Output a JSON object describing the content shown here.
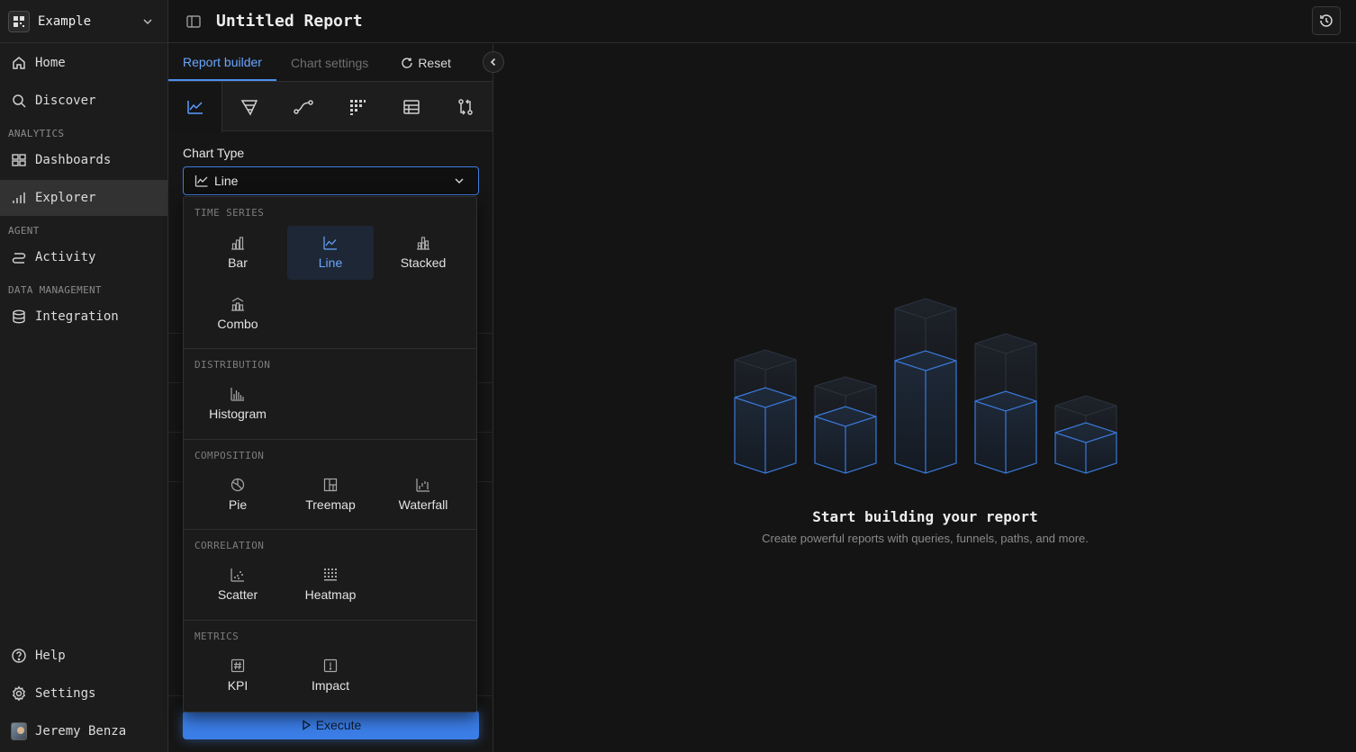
{
  "workspace": {
    "name": "Example"
  },
  "sidebar": {
    "home": "Home",
    "discover": "Discover",
    "section_analytics": "ANALYTICS",
    "dashboards": "Dashboards",
    "explorer": "Explorer",
    "section_agent": "AGENT",
    "activity": "Activity",
    "section_data": "DATA MANAGEMENT",
    "integration": "Integration",
    "help": "Help",
    "settings": "Settings",
    "user": "Jeremy Benza"
  },
  "header": {
    "title": "Untitled Report"
  },
  "tabs": {
    "report_builder": "Report builder",
    "chart_settings": "Chart settings",
    "reset": "Reset"
  },
  "chart_type": {
    "label": "Chart Type",
    "selected": "Line",
    "groups": {
      "time_series": {
        "title": "TIME SERIES",
        "options": [
          "Bar",
          "Line",
          "Stacked",
          "Combo"
        ]
      },
      "distribution": {
        "title": "DISTRIBUTION",
        "options": [
          "Histogram"
        ]
      },
      "composition": {
        "title": "COMPOSITION",
        "options": [
          "Pie",
          "Treemap",
          "Waterfall"
        ]
      },
      "correlation": {
        "title": "CORRELATION",
        "options": [
          "Scatter",
          "Heatmap"
        ]
      },
      "metrics": {
        "title": "METRICS",
        "options": [
          "KPI",
          "Impact"
        ]
      }
    }
  },
  "execute": "Execute",
  "empty_state": {
    "title": "Start building your report",
    "subtitle": "Create powerful reports with queries, funnels, paths, and more."
  },
  "colors": {
    "accent": "#3b7ee8",
    "accent_text": "#6aa6ff",
    "background": "#141414"
  }
}
